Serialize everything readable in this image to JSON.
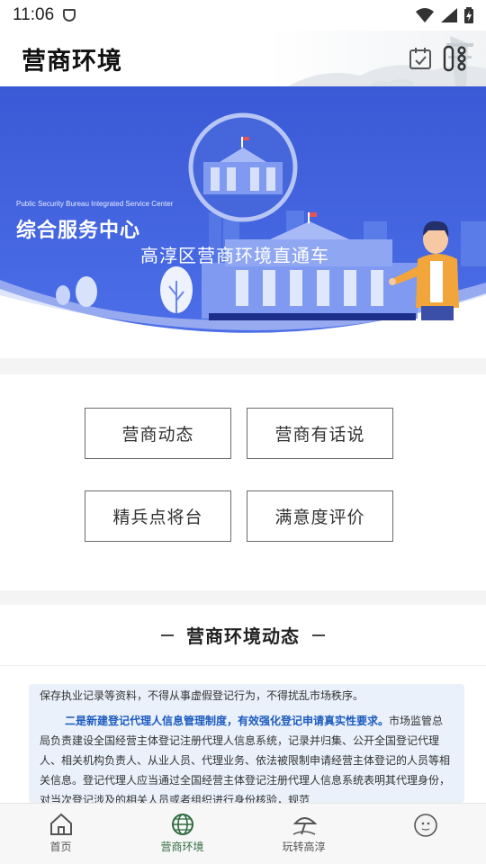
{
  "status_bar": {
    "time": "11:06"
  },
  "header": {
    "title": "营商环境"
  },
  "banner": {
    "subtitle_en": "Public Security Bureau Integrated Service Center",
    "title_cn": "综合服务中心",
    "tagline": "高淳区营商环境直通车"
  },
  "quick_links": [
    {
      "label": "营商动态"
    },
    {
      "label": "营商有话说"
    },
    {
      "label": "精兵点将台"
    },
    {
      "label": "满意度评价"
    }
  ],
  "section": {
    "title": "营商环境动态"
  },
  "article": {
    "line_first": "保存执业记录等资料，不得从事虚假登记行为，不得扰乱市场秩序。",
    "highlight": "二是新建登记代理人信息管理制度，有效强化登记申请真实性要求。",
    "body": "市场监管总局负责建设全国经营主体登记注册代理人信息系统，记录并归集、公开全国登记代理人、相关机构负责人、从业人员、代理业务、依法被限制申请经营主体登记的人员等相关信息。登记代理人应当通过全国经营主体登记注册代理人信息系统表明其代理身份，对当次登记涉及的相关人员或者组织进行身份核验，规范"
  },
  "bottom_nav": [
    {
      "label": "首页",
      "icon": "home-icon",
      "active": false
    },
    {
      "label": "营商环境",
      "icon": "globe-icon",
      "active": true
    },
    {
      "label": "玩转高淳",
      "icon": "umbrella-icon",
      "active": false
    },
    {
      "label": "",
      "icon": "avatar-icon",
      "active": false
    }
  ],
  "colors": {
    "banner_blue": "#3f5fdc",
    "active_green": "#2f6b3f",
    "article_highlight": "#1c5bbf"
  }
}
